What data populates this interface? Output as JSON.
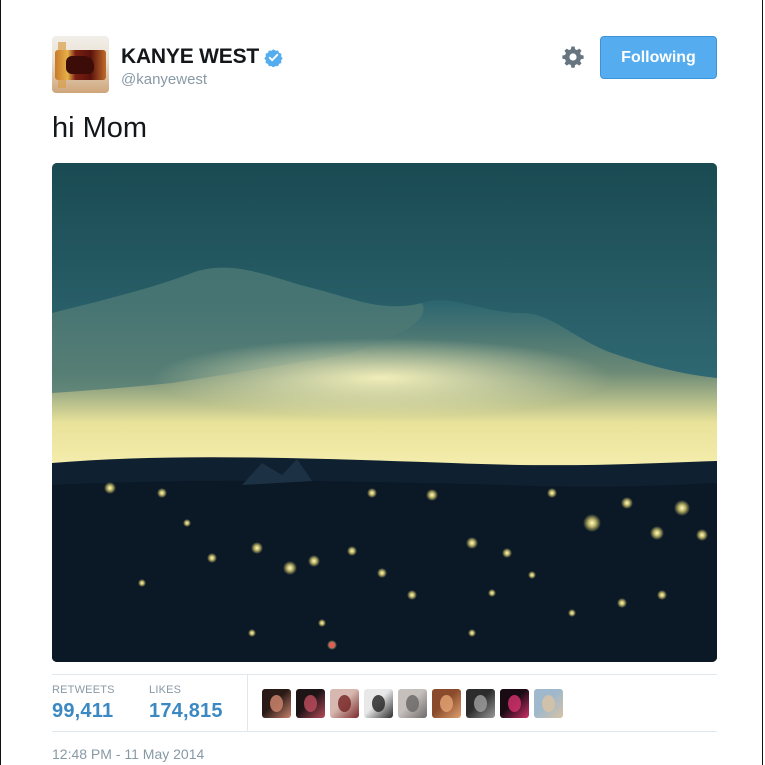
{
  "author": {
    "name": "KANYE WEST",
    "handle": "@kanyewest",
    "verified_color": "#55acee"
  },
  "follow_button": {
    "label": "Following",
    "color": "#55acee"
  },
  "settings_icon": "gear-icon",
  "tweet": {
    "text": "hi Mom"
  },
  "photo": {
    "subject": "city skyline at dusk"
  },
  "stats": {
    "retweets_label": "RETWEETS",
    "retweets_value": "99,411",
    "likes_label": "LIKES",
    "likes_value": "174,815",
    "liker_avatars": [
      {
        "colors": [
          "#2a1a16",
          "#c9826b"
        ]
      },
      {
        "colors": [
          "#1d1416",
          "#b84a5a"
        ]
      },
      {
        "colors": [
          "#d6b8b0",
          "#7a2a2a"
        ]
      },
      {
        "colors": [
          "#e8e8e8",
          "#2a2a2a"
        ]
      },
      {
        "colors": [
          "#c6c0bc",
          "#6d6a6a"
        ]
      },
      {
        "colors": [
          "#8a4b2c",
          "#e0a070"
        ]
      },
      {
        "colors": [
          "#2c2c2c",
          "#9a9a9a"
        ]
      },
      {
        "colors": [
          "#1a0a14",
          "#d0306a"
        ]
      },
      {
        "colors": [
          "#9fb8cc",
          "#d7c2a4"
        ]
      }
    ]
  },
  "timestamp": "12:48 PM - 11 May 2014"
}
